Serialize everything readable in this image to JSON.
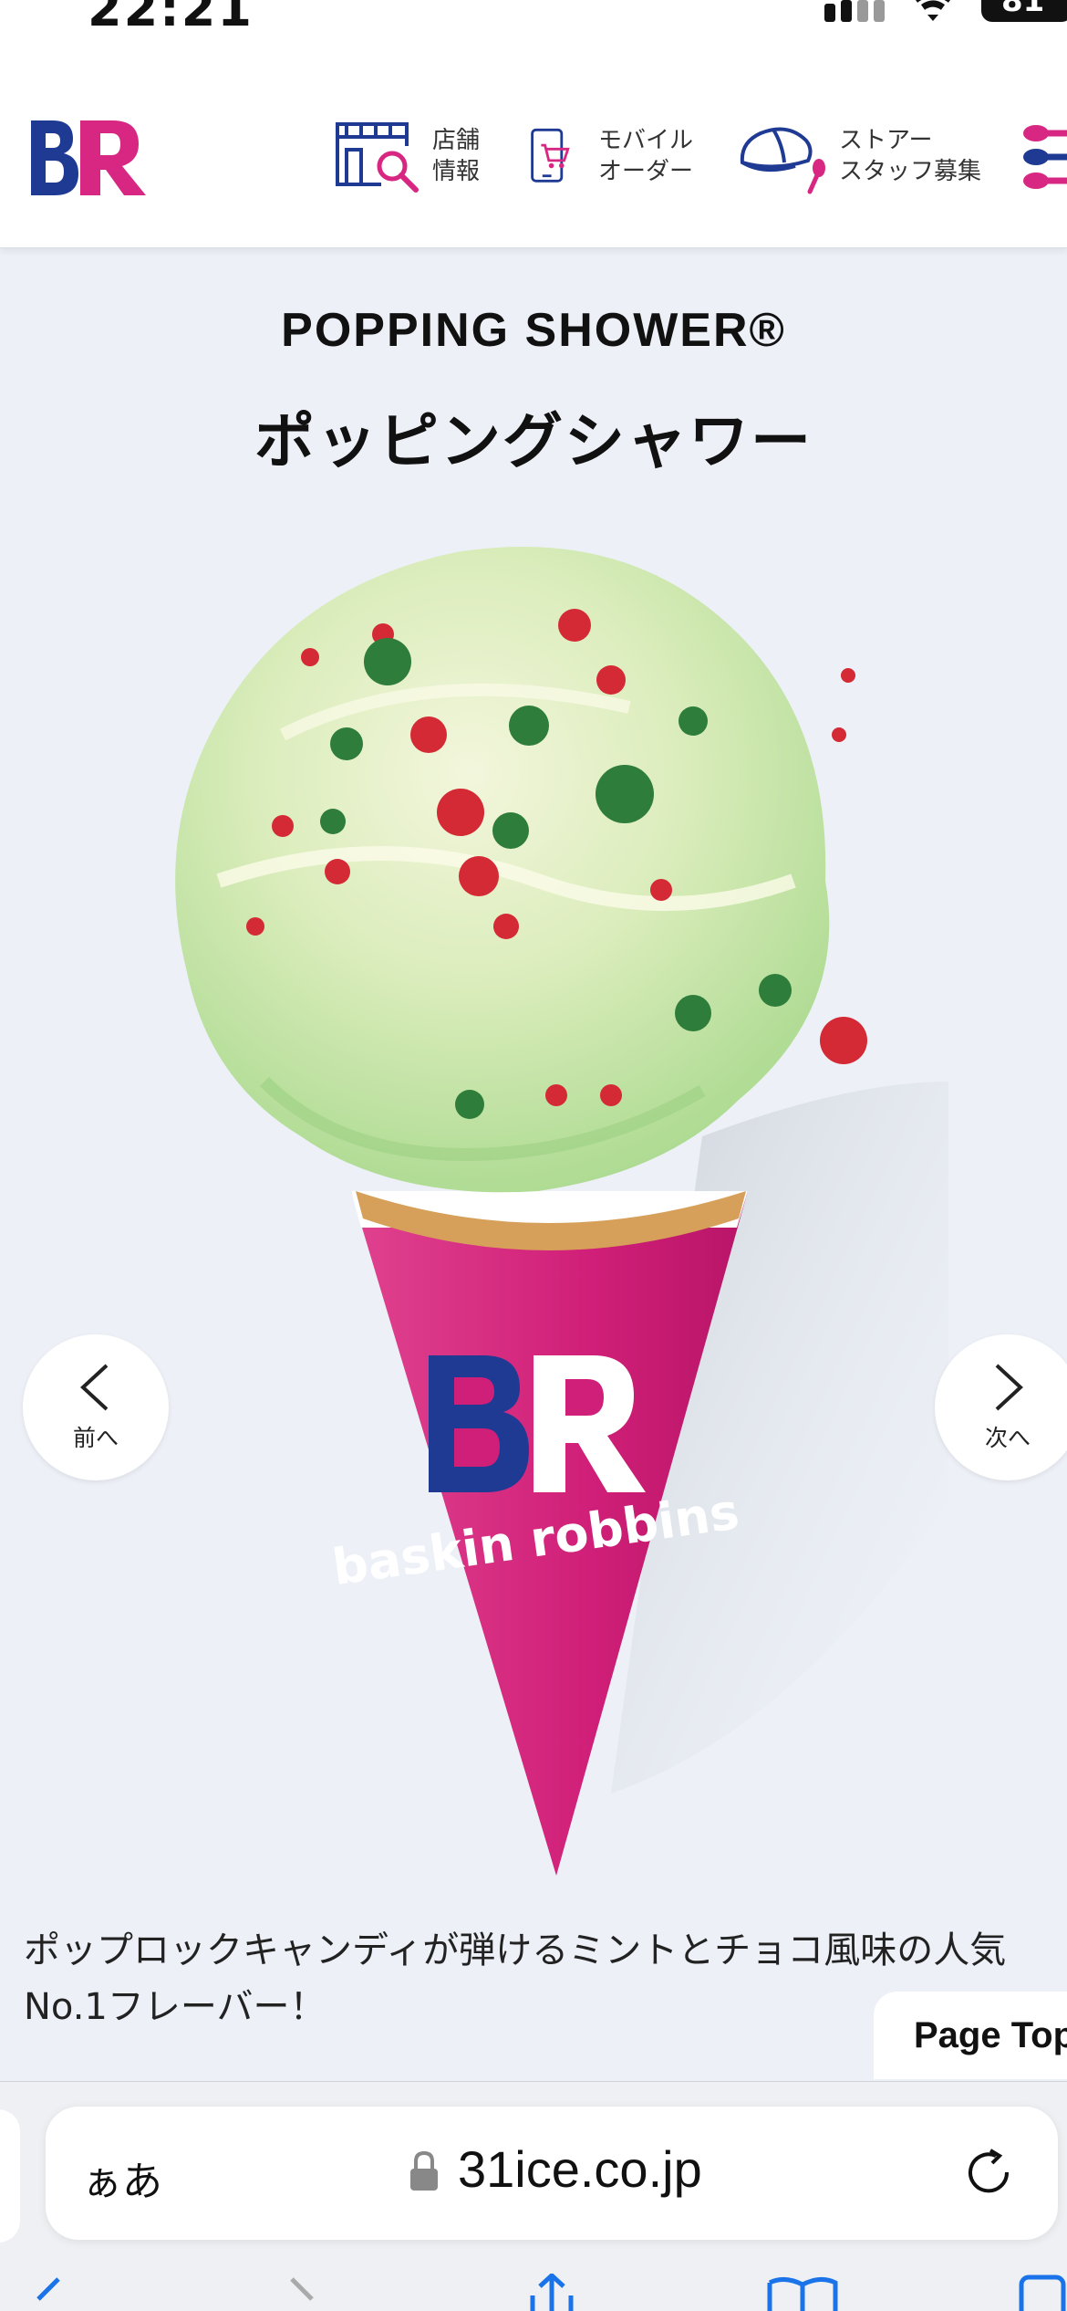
{
  "status": {
    "time": "22:21",
    "battery": "81"
  },
  "header": {
    "logo_alt": "BR",
    "nav": [
      {
        "label": "店舗\n情報",
        "icon": "store-search-icon"
      },
      {
        "label": "モバイル\nオーダー",
        "icon": "mobile-cart-icon"
      },
      {
        "label": "ストアー\nスタッフ募集",
        "icon": "cap-spoon-icon"
      }
    ],
    "more_icon": "spoons-menu-icon"
  },
  "product": {
    "title_en": "POPPING SHOWER®",
    "title_ja": "ポッピングシャワー",
    "description": "ポップロックキャンディが弾けるミントとチョコ風味の人気No.1フレーバー！",
    "cone_text": "baskin robbins"
  },
  "carousel": {
    "prev_label": "前へ",
    "next_label": "次へ"
  },
  "page_top": "Page Top",
  "browser": {
    "aa": "ぁあ",
    "domain": "31ice.co.jp"
  },
  "colors": {
    "brand_pink": "#d72782",
    "brand_blue": "#1f3a93",
    "mint": "#b7e0a0",
    "background": "#edf1f7"
  }
}
